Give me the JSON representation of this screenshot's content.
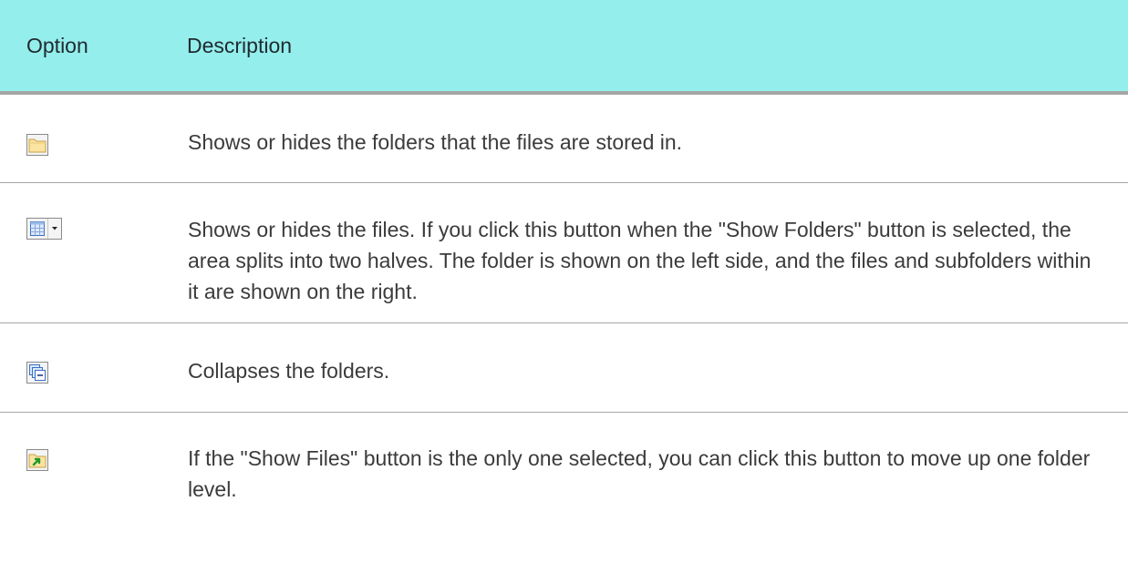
{
  "table": {
    "headers": {
      "option": "Option",
      "description": "Description"
    },
    "rows": [
      {
        "icon": "show-folders-icon",
        "description": "Shows or hides the folders that the files are stored in."
      },
      {
        "icon": "show-files-icon",
        "description": "Shows or hides the files. If you click this button when the \"Show Folders\" button is selected, the area splits into two halves. The folder is shown on the left side, and the files and subfolders within it are shown on the right."
      },
      {
        "icon": "collapse-folders-icon",
        "description": "Collapses the folders."
      },
      {
        "icon": "up-one-level-icon",
        "description": "If the \"Show Files\" button is the only one selected, you can click this button to move up one folder level."
      }
    ]
  },
  "colors": {
    "header_background": "#94eeec",
    "header_rule": "#a6a6a6",
    "row_divider": "#a6a6a6",
    "text": "#3b3b3b"
  }
}
